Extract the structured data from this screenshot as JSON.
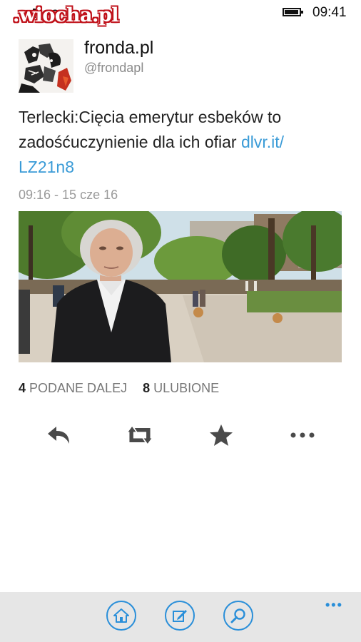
{
  "status_bar": {
    "network": "4G",
    "time": "09:41",
    "watermark": ".wiocha.pl"
  },
  "profile": {
    "display_name": "fronda.pl",
    "handle": "@frondapl"
  },
  "tweet": {
    "text": "Terlecki:Cięcia emerytur esbeków to zadośćuczynienie dla ich ofiar ",
    "link": "dlvr.it/ LZ21n8",
    "timestamp": "09:16 - 15 cze 16"
  },
  "stats": {
    "retweets_count": "4",
    "retweets_label": "PODANE DALEJ",
    "favorites_count": "8",
    "favorites_label": "ULUBIONE"
  },
  "actions": [
    "reply-icon",
    "retweet-icon",
    "favorite-icon",
    "more-icon"
  ],
  "appbar": {
    "buttons": [
      "home-icon",
      "compose-icon",
      "search-icon"
    ],
    "more": "•••"
  },
  "colors": {
    "link": "#3a9bd7",
    "accent": "#2a8fd9",
    "appbar_bg": "#e6e6e6",
    "watermark": "#c0121b"
  }
}
